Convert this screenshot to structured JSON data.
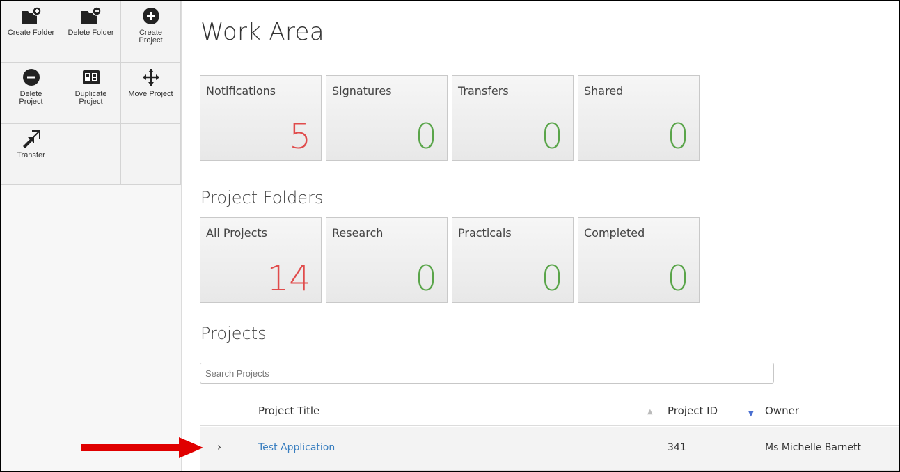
{
  "toolbar": {
    "items": [
      {
        "label": "Create Folder",
        "icon": "folder-plus-icon"
      },
      {
        "label": "Delete Folder",
        "icon": "folder-minus-icon"
      },
      {
        "label": "Create\nProject",
        "icon": "plus-circle-icon"
      },
      {
        "label": "Delete\nProject",
        "icon": "minus-circle-icon"
      },
      {
        "label": "Duplicate\nProject",
        "icon": "duplicate-icon"
      },
      {
        "label": "Move Project",
        "icon": "move-arrows-icon"
      },
      {
        "label": "Transfer",
        "icon": "transfer-icon"
      }
    ]
  },
  "page": {
    "title": "Work Area"
  },
  "work_tiles": [
    {
      "label": "Notifications",
      "count": "5"
    },
    {
      "label": "Signatures",
      "count": "0"
    },
    {
      "label": "Transfers",
      "count": "0"
    },
    {
      "label": "Shared",
      "count": "0"
    }
  ],
  "folders_section": {
    "title": "Project Folders"
  },
  "folder_tiles": [
    {
      "label": "All Projects",
      "count": "14"
    },
    {
      "label": "Research",
      "count": "0"
    },
    {
      "label": "Practicals",
      "count": "0"
    },
    {
      "label": "Completed",
      "count": "0"
    }
  ],
  "projects_section": {
    "title": "Projects",
    "search_placeholder": "Search Projects"
  },
  "table": {
    "columns": [
      "Project Title",
      "Project ID",
      "Owner"
    ],
    "rows": [
      {
        "expand_glyph": "›",
        "title": "Test Application",
        "id": "341",
        "owner": "Ms Michelle Barnett"
      }
    ]
  },
  "colors": {
    "accent_red": "#e04b4b",
    "accent_green": "#5aa54a",
    "link": "#3a7fc0",
    "annotation_arrow": "#e00000"
  }
}
